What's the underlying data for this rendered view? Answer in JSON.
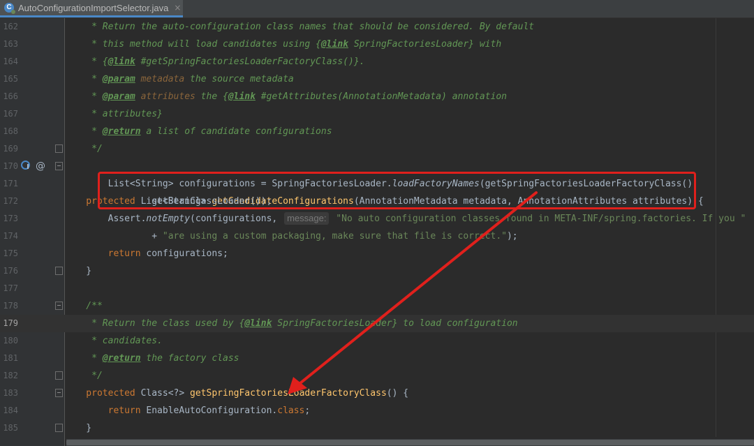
{
  "tab": {
    "title": "AutoConfigurationImportSelector.java",
    "close_glyph": "×",
    "icon_letter": "C"
  },
  "gutter_icons": [
    "implementation-icon",
    "override-at-icon"
  ],
  "lines": [
    {
      "num": "162"
    },
    {
      "num": "163"
    },
    {
      "num": "164"
    },
    {
      "num": "165"
    },
    {
      "num": "166"
    },
    {
      "num": "167"
    },
    {
      "num": "168"
    },
    {
      "num": "169"
    },
    {
      "num": "170"
    },
    {
      "num": "171"
    },
    {
      "num": "172"
    },
    {
      "num": "173"
    },
    {
      "num": "174"
    },
    {
      "num": "175"
    },
    {
      "num": "176"
    },
    {
      "num": "177"
    },
    {
      "num": "178"
    },
    {
      "num": "179"
    },
    {
      "num": "180"
    },
    {
      "num": "181"
    },
    {
      "num": "182"
    },
    {
      "num": "183"
    },
    {
      "num": "184"
    },
    {
      "num": "185"
    }
  ],
  "code": {
    "l162": "     * Return the auto-configuration class names that should be considered. By default",
    "l163_a": "     * this method will load candidates using {",
    "l163_tag": "@link",
    "l163_b": " SpringFactoriesLoader} with",
    "l164_a": "     * {",
    "l164_tag": "@link",
    "l164_b": " #getSpringFactoriesLoaderFactoryClass()}.",
    "l165_a": "     * ",
    "l165_tag": "@param",
    "l165_name": " metadata",
    "l165_b": " the source metadata",
    "l166_a": "     * ",
    "l166_tag": "@param",
    "l166_name": " attributes",
    "l166_b": " the {",
    "l166_tag2": "@link",
    "l166_c": " #getAttributes(AnnotationMetadata) annotation",
    "l167": "     * attributes}",
    "l168_a": "     * ",
    "l168_tag": "@return",
    "l168_b": " a list of candidate configurations",
    "l169": "     */",
    "l170_kw": "    protected",
    "l170_a": " List<String> ",
    "l170_m": "getCandidateConfigurations",
    "l170_b": "(AnnotationMetadata metadata, AnnotationAttributes attributes) {",
    "l171_a": "        List<String> configurations = SpringFactoriesLoader.",
    "l171_it": "loadFactoryNames",
    "l171_b": "(getSpringFactoriesLoaderFactoryClass(),",
    "l172": "                getBeanClassLoader());",
    "l173_a": "        Assert.",
    "l173_it": "notEmpty",
    "l173_b": "(configurations, ",
    "l173_hint": "message:",
    "l173_s": " \"No auto configuration classes found in META-INF/spring.factories. If you \"",
    "l174_a": "                + ",
    "l174_s": "\"are using a custom packaging, make sure that file is correct.\"",
    "l174_b": ");",
    "l175_kw": "        return",
    "l175_a": " configurations;",
    "l176": "    }",
    "l177": "",
    "l178": "    /**",
    "l179_a": "     * Return the class used by {",
    "l179_tag": "@link",
    "l179_b": " SpringFactoriesLoader} to load configuration",
    "l180": "     * candidates.",
    "l181_a": "     * ",
    "l181_tag": "@return",
    "l181_b": " the factory class",
    "l182": "     */",
    "l183_kw": "    protected",
    "l183_a": " Class<?> ",
    "l183_m": "getSpringFactoriesLoaderFactoryClass",
    "l183_b": "() {",
    "l184_kw": "        return",
    "l184_a": " EnableAutoConfiguration.",
    "l184_kw2": "class",
    "l184_b": ";",
    "l185": "    }"
  },
  "annotation": {
    "box_color": "#e0201c",
    "arrow_color": "#e0201c"
  },
  "colors": {
    "background": "#2b2b2b",
    "gutter": "#313335",
    "comment": "#629755",
    "keyword": "#cc7832",
    "method": "#ffc66d",
    "string": "#6a8759",
    "text": "#a9b7c6"
  }
}
